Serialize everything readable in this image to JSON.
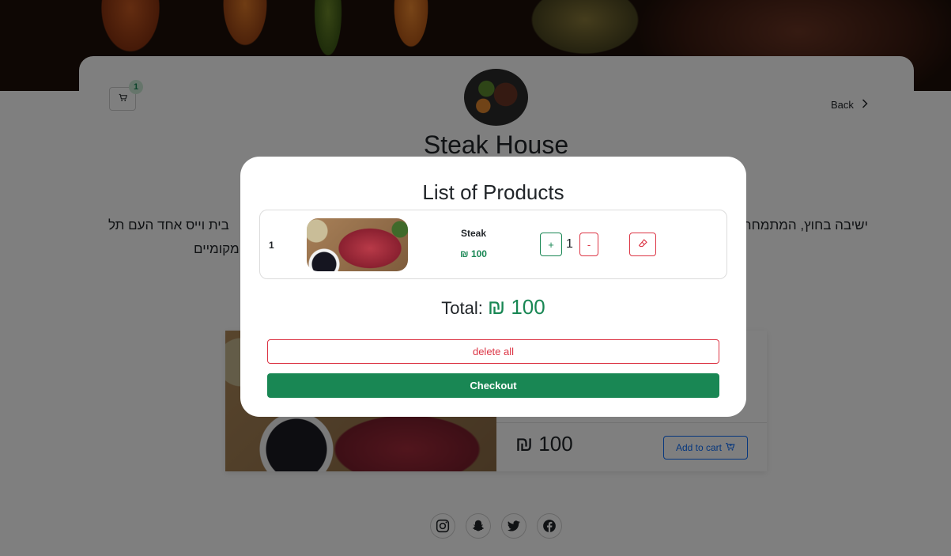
{
  "page": {
    "restaurant_name": "Steak House",
    "back_label": "Back",
    "cart_count": "1",
    "description_line1_right": "בית וייס אחד העם תל",
    "description_line1_left": "ישיבה בחוץ, המתמחה",
    "description_line2": "מקומיים",
    "product": {
      "price": "₪ 100",
      "add_to_cart_label": "Add to cart"
    },
    "socials": [
      "instagram-icon",
      "snapchat-icon",
      "twitter-icon",
      "facebook-icon"
    ]
  },
  "modal": {
    "title": "List of Products",
    "items": [
      {
        "index": "1",
        "name": "Steak",
        "price": "₪ 100",
        "quantity": "1"
      }
    ],
    "plus_label": "+",
    "minus_label": "-",
    "total_label": "Total:",
    "total_amount": "₪ 100",
    "delete_all_label": "delete all",
    "checkout_label": "Checkout"
  },
  "colors": {
    "success": "#198754",
    "danger": "#dc3545",
    "primary": "#0d6efd",
    "overlay": "rgba(0,0,0,0.5)"
  }
}
